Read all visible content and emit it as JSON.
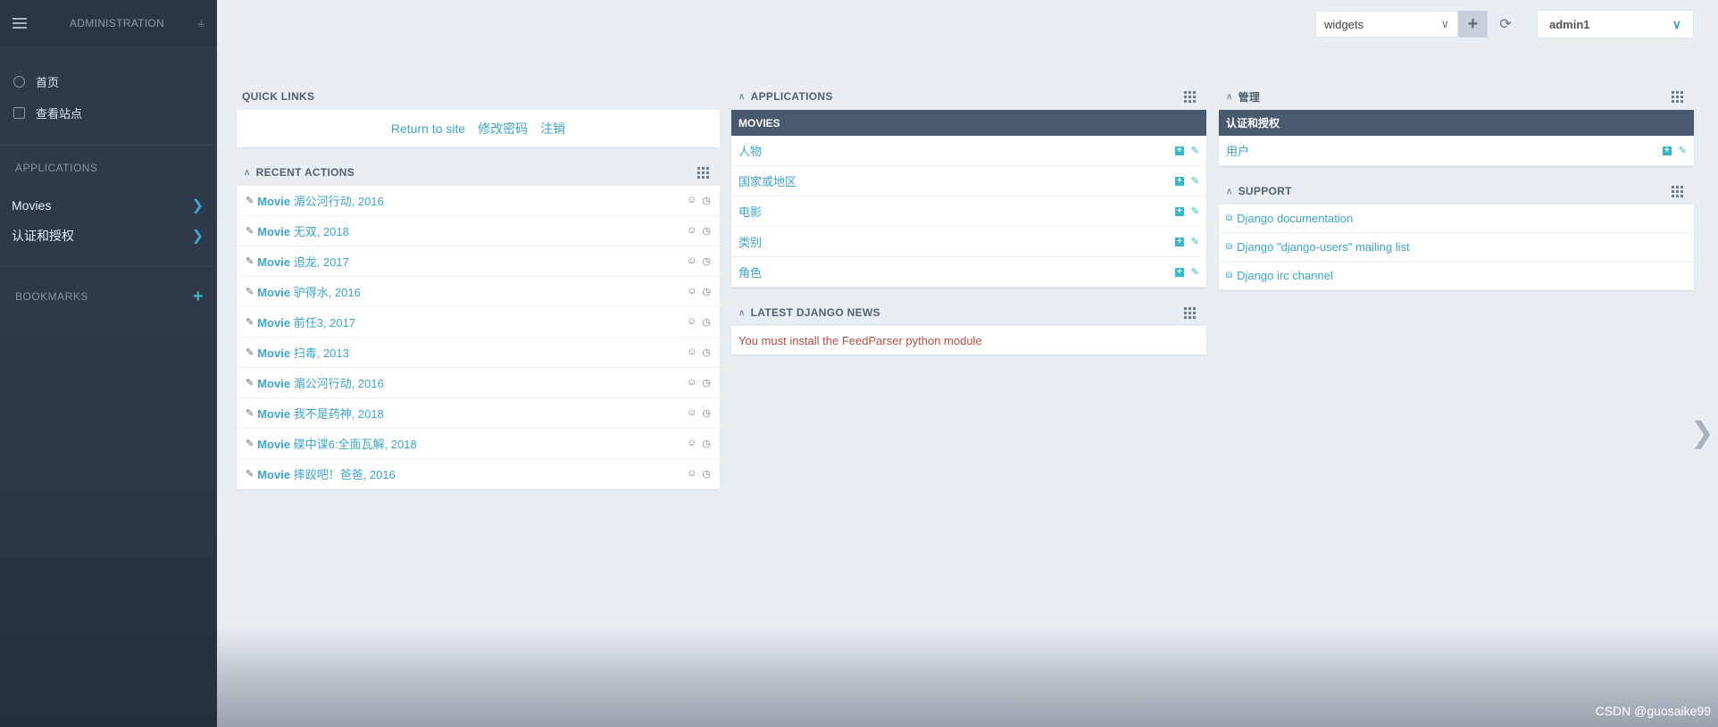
{
  "sidebar": {
    "brand": "ADMINISTRATION",
    "nav": [
      {
        "label": "首页",
        "icon": "circle-icon"
      },
      {
        "label": "查看站点",
        "icon": "external-site-icon"
      }
    ],
    "applications_header": "APPLICATIONS",
    "apps": [
      {
        "label": "Movies"
      },
      {
        "label": "认证和授权"
      }
    ],
    "bookmarks_header": "BOOKMARKS"
  },
  "topbar": {
    "widgets_select": "widgets",
    "user": "admin1"
  },
  "quick_links": {
    "title": "QUICK LINKS",
    "links": [
      "Return to site",
      "修改密码",
      "注销"
    ]
  },
  "recent_actions": {
    "title": "RECENT ACTIONS",
    "items": [
      {
        "prefix": "Movie",
        "name": "湄公河行动, 2016"
      },
      {
        "prefix": "Movie",
        "name": "无双, 2018"
      },
      {
        "prefix": "Movie",
        "name": "追龙, 2017"
      },
      {
        "prefix": "Movie",
        "name": "驴得水, 2016"
      },
      {
        "prefix": "Movie",
        "name": "前任3, 2017"
      },
      {
        "prefix": "Movie",
        "name": "扫毒, 2013"
      },
      {
        "prefix": "Movie",
        "name": "湄公河行动, 2016"
      },
      {
        "prefix": "Movie",
        "name": "我不是药神, 2018"
      },
      {
        "prefix": "Movie",
        "name": "碟中谍6:全面瓦解, 2018"
      },
      {
        "prefix": "Movie",
        "name": "摔跤吧！爸爸, 2016"
      }
    ]
  },
  "applications": {
    "title": "APPLICATIONS",
    "group": "MOVIES",
    "models": [
      "人物",
      "国家或地区",
      "电影",
      "类别",
      "角色"
    ]
  },
  "news": {
    "title": "LATEST DJANGO NEWS",
    "message": "You must install the FeedParser python module"
  },
  "admin_box": {
    "title": "管理",
    "group": "认证和授权",
    "models": [
      "用户"
    ]
  },
  "support": {
    "title": "SUPPORT",
    "links": [
      "Django documentation",
      "Django \"django-users\" mailing list",
      "Django irc channel"
    ]
  },
  "watermark": "CSDN @guosaike99"
}
